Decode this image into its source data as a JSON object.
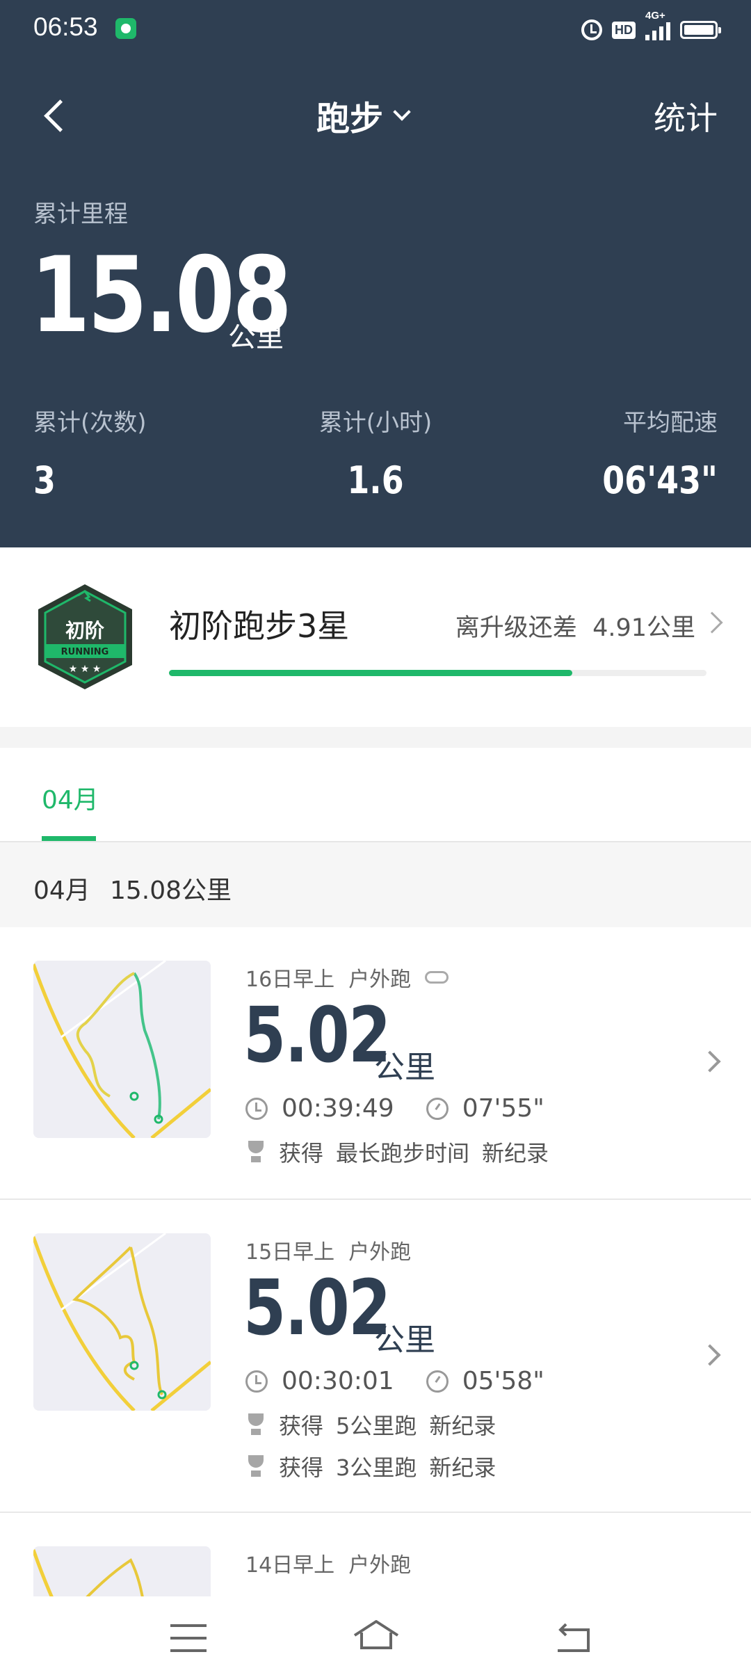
{
  "status_bar": {
    "time": "06:53",
    "hd": "HD",
    "network": "4G+"
  },
  "header": {
    "title": "跑步",
    "stats_link": "统计"
  },
  "summary": {
    "total_label": "累计里程",
    "total_value": "15.08",
    "total_unit": "公里",
    "count_label": "累计(次数)",
    "count_value": "3",
    "hours_label": "累计(小时)",
    "hours_value": "1.6",
    "pace_label": "平均配速",
    "pace_value": "06'43\""
  },
  "level": {
    "badge_text": "初阶",
    "badge_sub": "RUNNING",
    "name": "初阶跑步3星",
    "remain_text": "离升级还差",
    "remain_value": "4.91公里",
    "progress": 0.75
  },
  "tabs": {
    "active": "04月"
  },
  "month_summary": {
    "month": "04月",
    "distance": "15.08公里"
  },
  "records": [
    {
      "when": "16日早上",
      "kind": "户外跑",
      "weather_icon": "cloud-icon",
      "distance": "5.02",
      "unit": "公里",
      "duration": "00:39:49",
      "pace": "07'55\"",
      "achievements": [
        {
          "verb": "获得",
          "item": "最长跑步时间",
          "tag": "新纪录"
        }
      ]
    },
    {
      "when": "15日早上",
      "kind": "户外跑",
      "distance": "5.02",
      "unit": "公里",
      "duration": "00:30:01",
      "pace": "05'58\"",
      "achievements": [
        {
          "verb": "获得",
          "item": "5公里跑",
          "tag": "新纪录"
        },
        {
          "verb": "获得",
          "item": "3公里跑",
          "tag": "新纪录"
        }
      ]
    },
    {
      "when": "14日早上",
      "kind": "户外跑"
    }
  ],
  "colors": {
    "header_bg": "#2f3f52",
    "accent": "#1fb86a",
    "route": "#f2cf3a"
  }
}
